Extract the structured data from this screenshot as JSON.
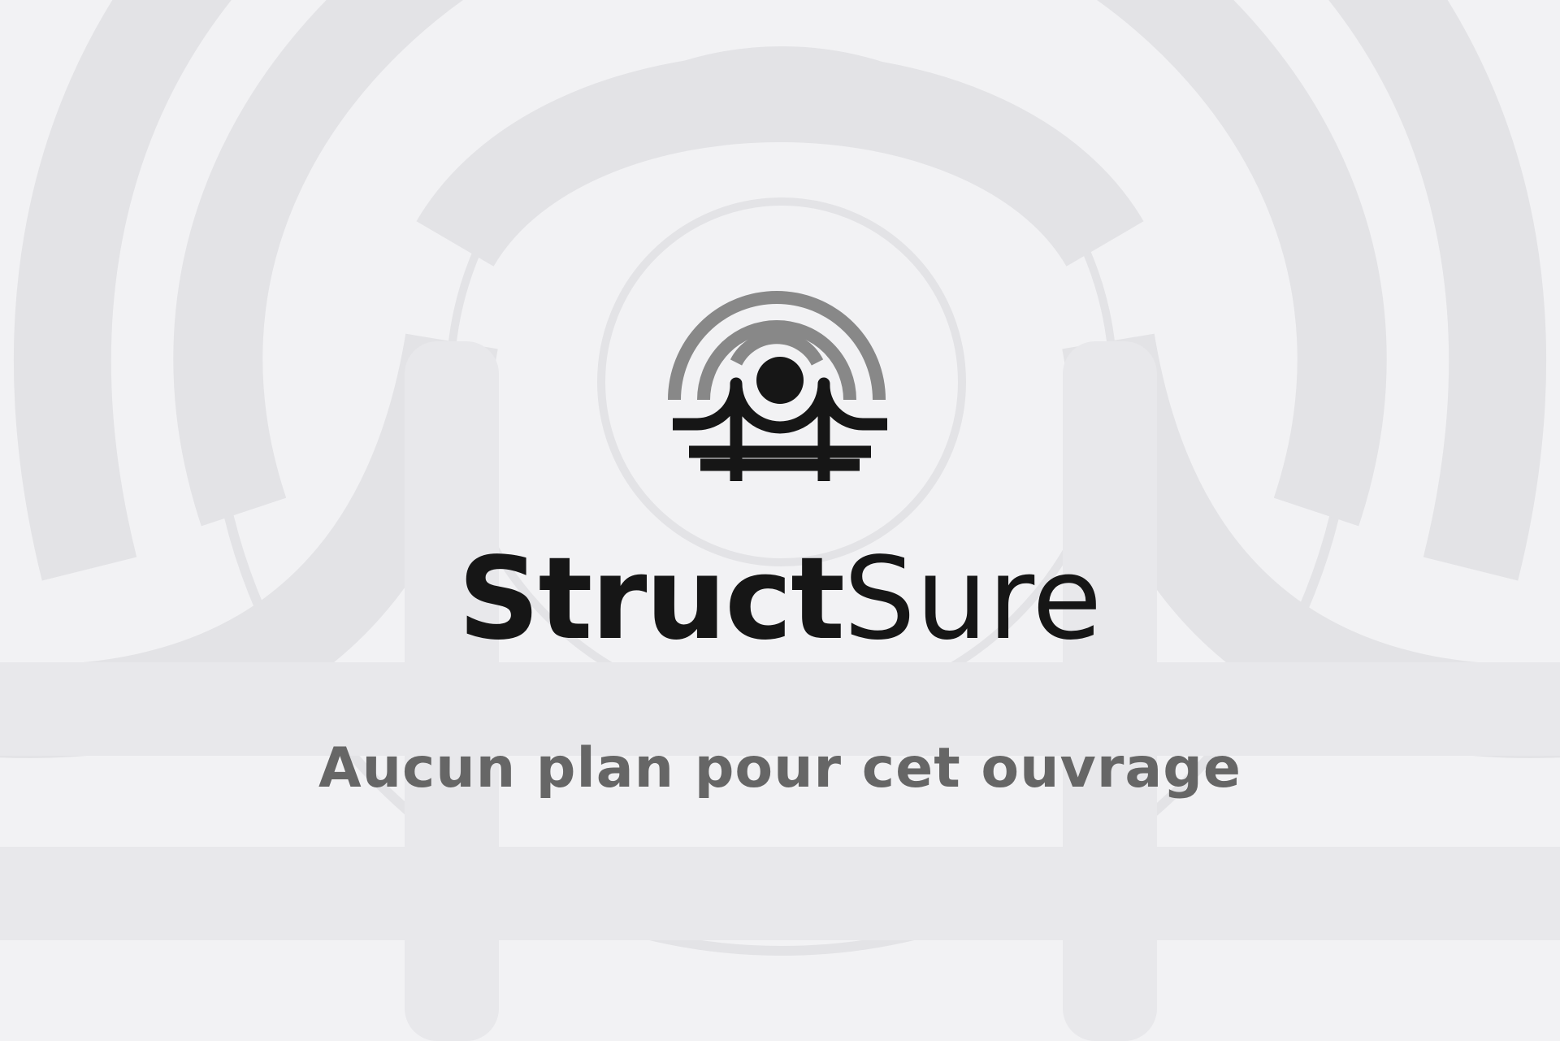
{
  "brand": {
    "name_bold": "Struct",
    "name_light": "Sure"
  },
  "message": "Aucun plan pour cet ouvrage",
  "colors": {
    "background": "#f2f2f4",
    "wordmark": "#161616",
    "message": "#666666",
    "logo_arcs": "#888888",
    "logo_bridge": "#161616"
  },
  "icons": {
    "logo": "bridge-signal-logo-icon"
  }
}
